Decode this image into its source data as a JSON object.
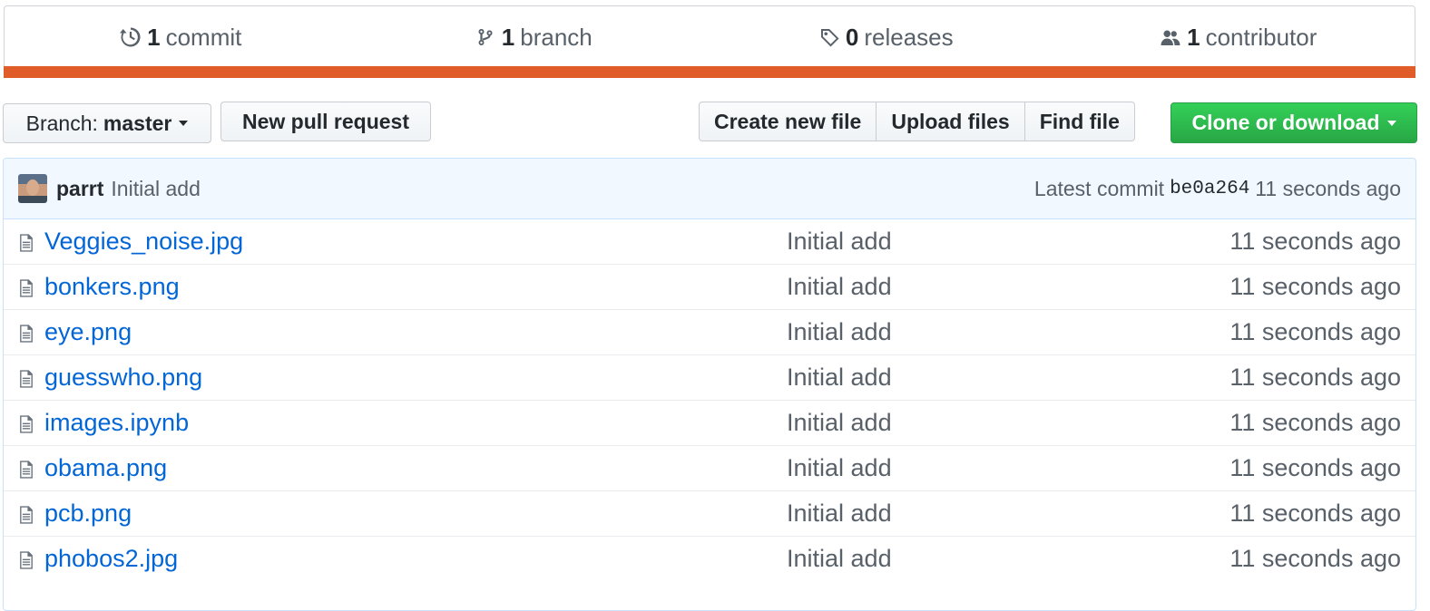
{
  "summary": {
    "commits": {
      "count": "1",
      "label": "commit"
    },
    "branches": {
      "count": "1",
      "label": "branch"
    },
    "releases": {
      "count": "0",
      "label": "releases"
    },
    "contributors": {
      "count": "1",
      "label": "contributor"
    },
    "language_bar_color": "#e05d2a"
  },
  "toolbar": {
    "branch_prefix": "Branch:",
    "branch_name": "master",
    "new_pull_request": "New pull request",
    "create_new_file": "Create new file",
    "upload_files": "Upload files",
    "find_file": "Find file",
    "clone_or_download": "Clone or download"
  },
  "commit": {
    "author": "parrt",
    "message": "Initial add",
    "latest_label": "Latest commit",
    "sha": "be0a264",
    "age": "11 seconds ago"
  },
  "files": [
    {
      "name": "Veggies_noise.jpg",
      "message": "Initial add",
      "age": "11 seconds ago"
    },
    {
      "name": "bonkers.png",
      "message": "Initial add",
      "age": "11 seconds ago"
    },
    {
      "name": "eye.png",
      "message": "Initial add",
      "age": "11 seconds ago"
    },
    {
      "name": "guesswho.png",
      "message": "Initial add",
      "age": "11 seconds ago"
    },
    {
      "name": "images.ipynb",
      "message": "Initial add",
      "age": "11 seconds ago"
    },
    {
      "name": "obama.png",
      "message": "Initial add",
      "age": "11 seconds ago"
    },
    {
      "name": "pcb.png",
      "message": "Initial add",
      "age": "11 seconds ago"
    },
    {
      "name": "phobos2.jpg",
      "message": "Initial add",
      "age": "11 seconds ago"
    }
  ],
  "colors": {
    "link": "#0366d6",
    "clone_button": "#2cbe4e",
    "commit_tease_bg": "#f1f8ff"
  }
}
